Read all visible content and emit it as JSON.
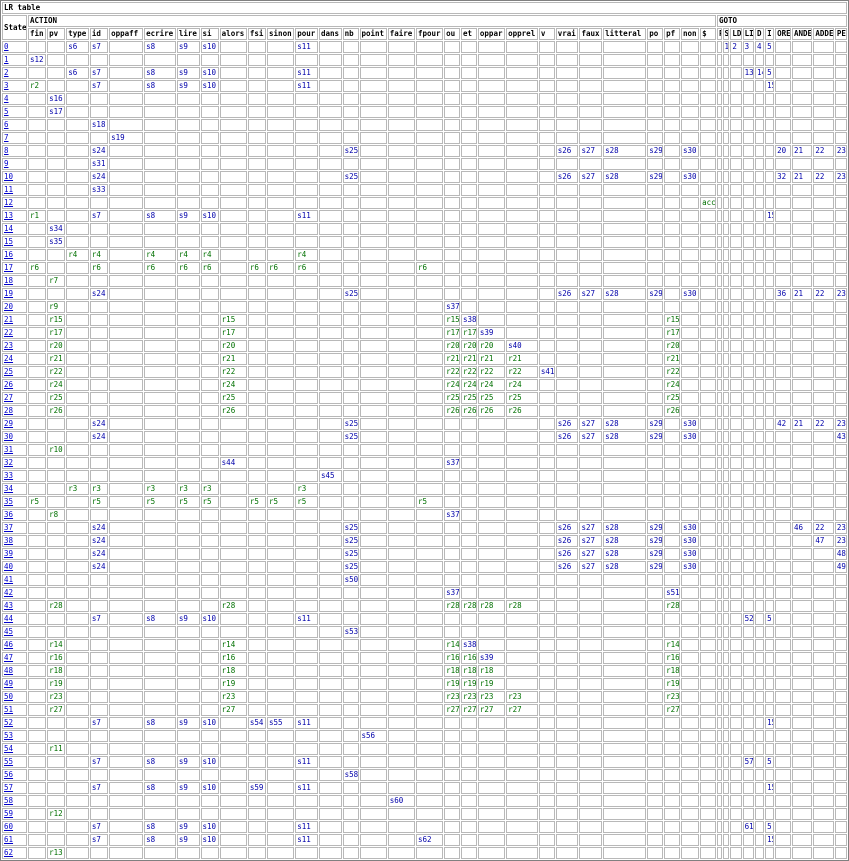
{
  "table_title": "LR table",
  "group_headers": {
    "state": "State",
    "action": "ACTION",
    "goto": "GOTO"
  },
  "action_columns": [
    "fin",
    "pv",
    "type",
    "id",
    "oppaff",
    "ecrire",
    "lire",
    "si",
    "alors",
    "fsi",
    "sinon",
    "pour",
    "dans",
    "nb",
    "point",
    "faire",
    "fpour",
    "ou",
    "et",
    "oppar",
    "opprel",
    "v",
    "vrai",
    "faux",
    "litteral",
    "po",
    "pf",
    "non",
    "$"
  ],
  "goto_columns": [
    "P",
    "S",
    "LD",
    "LI",
    "D",
    "I",
    "ORE",
    "ANDE",
    "ADDE",
    "PE"
  ],
  "rows": [
    {
      "state": "0",
      "cells": {
        "type": "s6",
        "id": "s7",
        "ecrire": "s8",
        "lire": "s9",
        "si": "s10",
        "pour": "s11",
        "S": "1",
        "LD": "2",
        "LI": "3",
        "D": "4",
        "I": "5"
      }
    },
    {
      "state": "1",
      "cells": {
        "fin": "s12"
      }
    },
    {
      "state": "2",
      "cells": {
        "type": "s6",
        "id": "s7",
        "ecrire": "s8",
        "lire": "s9",
        "si": "s10",
        "pour": "s11",
        "LI": "13",
        "D": "14",
        "I": "5"
      }
    },
    {
      "state": "3",
      "cells": {
        "fin": "r2",
        "id": "s7",
        "ecrire": "s8",
        "lire": "s9",
        "si": "s10",
        "pour": "s11",
        "I": "15"
      }
    },
    {
      "state": "4",
      "cells": {
        "pv": "s16"
      }
    },
    {
      "state": "5",
      "cells": {
        "pv": "s17"
      }
    },
    {
      "state": "6",
      "cells": {
        "id": "s18"
      }
    },
    {
      "state": "7",
      "cells": {
        "oppaff": "s19"
      }
    },
    {
      "state": "8",
      "cells": {
        "id": "s24",
        "nb": "s25",
        "vrai": "s26",
        "faux": "s27",
        "litteral": "s28",
        "po": "s29",
        "non": "s30",
        "ORE": "20",
        "ANDE": "21",
        "ADDE": "22",
        "PE": "23"
      }
    },
    {
      "state": "9",
      "cells": {
        "id": "s31"
      }
    },
    {
      "state": "10",
      "cells": {
        "id": "s24",
        "nb": "s25",
        "vrai": "s26",
        "faux": "s27",
        "litteral": "s28",
        "po": "s29",
        "non": "s30",
        "ORE": "32",
        "ANDE": "21",
        "ADDE": "22",
        "PE": "23"
      }
    },
    {
      "state": "11",
      "cells": {
        "id": "s33"
      }
    },
    {
      "state": "12",
      "cells": {
        "$": "acc"
      }
    },
    {
      "state": "13",
      "cells": {
        "fin": "r1",
        "id": "s7",
        "ecrire": "s8",
        "lire": "s9",
        "si": "s10",
        "pour": "s11",
        "I": "15"
      }
    },
    {
      "state": "14",
      "cells": {
        "pv": "s34"
      }
    },
    {
      "state": "15",
      "cells": {
        "pv": "s35"
      }
    },
    {
      "state": "16",
      "cells": {
        "type": "r4",
        "id": "r4",
        "ecrire": "r4",
        "lire": "r4",
        "si": "r4",
        "pour": "r4"
      }
    },
    {
      "state": "17",
      "cells": {
        "fin": "r6",
        "id": "r6",
        "ecrire": "r6",
        "lire": "r6",
        "si": "r6",
        "fsi": "r6",
        "sinon": "r6",
        "pour": "r6",
        "fpour": "r6"
      }
    },
    {
      "state": "18",
      "cells": {
        "pv": "r7"
      }
    },
    {
      "state": "19",
      "cells": {
        "id": "s24",
        "nb": "s25",
        "vrai": "s26",
        "faux": "s27",
        "litteral": "s28",
        "po": "s29",
        "non": "s30",
        "ORE": "36",
        "ANDE": "21",
        "ADDE": "22",
        "PE": "23"
      }
    },
    {
      "state": "20",
      "cells": {
        "pv": "r9",
        "ou": "s37"
      }
    },
    {
      "state": "21",
      "cells": {
        "pv": "r15",
        "alors": "r15",
        "ou": "r15",
        "et": "s38",
        "pf": "r15"
      }
    },
    {
      "state": "22",
      "cells": {
        "pv": "r17",
        "alors": "r17",
        "ou": "r17",
        "et": "r17",
        "oppar": "s39",
        "pf": "r17"
      }
    },
    {
      "state": "23",
      "cells": {
        "pv": "r20",
        "alors": "r20",
        "ou": "r20",
        "et": "r20",
        "oppar": "r20",
        "opprel": "s40",
        "pf": "r20"
      }
    },
    {
      "state": "24",
      "cells": {
        "pv": "r21",
        "alors": "r21",
        "ou": "r21",
        "et": "r21",
        "oppar": "r21",
        "opprel": "r21",
        "pf": "r21"
      }
    },
    {
      "state": "25",
      "cells": {
        "pv": "r22",
        "alors": "r22",
        "ou": "r22",
        "et": "r22",
        "oppar": "r22",
        "opprel": "r22",
        "v": "s41",
        "pf": "r22"
      }
    },
    {
      "state": "26",
      "cells": {
        "pv": "r24",
        "alors": "r24",
        "ou": "r24",
        "et": "r24",
        "oppar": "r24",
        "opprel": "r24",
        "pf": "r24"
      }
    },
    {
      "state": "27",
      "cells": {
        "pv": "r25",
        "alors": "r25",
        "ou": "r25",
        "et": "r25",
        "oppar": "r25",
        "opprel": "r25",
        "pf": "r25"
      }
    },
    {
      "state": "28",
      "cells": {
        "pv": "r26",
        "alors": "r26",
        "ou": "r26",
        "et": "r26",
        "oppar": "r26",
        "opprel": "r26",
        "pf": "r26"
      }
    },
    {
      "state": "29",
      "cells": {
        "id": "s24",
        "nb": "s25",
        "vrai": "s26",
        "faux": "s27",
        "litteral": "s28",
        "po": "s29",
        "non": "s30",
        "ORE": "42",
        "ANDE": "21",
        "ADDE": "22",
        "PE": "23"
      }
    },
    {
      "state": "30",
      "cells": {
        "id": "s24",
        "nb": "s25",
        "vrai": "s26",
        "faux": "s27",
        "litteral": "s28",
        "po": "s29",
        "non": "s30",
        "PE": "43"
      }
    },
    {
      "state": "31",
      "cells": {
        "pv": "r10"
      }
    },
    {
      "state": "32",
      "cells": {
        "alors": "s44",
        "ou": "s37"
      }
    },
    {
      "state": "33",
      "cells": {
        "dans": "s45"
      }
    },
    {
      "state": "34",
      "cells": {
        "type": "r3",
        "id": "r3",
        "ecrire": "r3",
        "lire": "r3",
        "si": "r3",
        "pour": "r3"
      }
    },
    {
      "state": "35",
      "cells": {
        "fin": "r5",
        "id": "r5",
        "ecrire": "r5",
        "lire": "r5",
        "si": "r5",
        "fsi": "r5",
        "sinon": "r5",
        "pour": "r5",
        "fpour": "r5"
      }
    },
    {
      "state": "36",
      "cells": {
        "pv": "r8",
        "ou": "s37"
      }
    },
    {
      "state": "37",
      "cells": {
        "id": "s24",
        "nb": "s25",
        "vrai": "s26",
        "faux": "s27",
        "litteral": "s28",
        "po": "s29",
        "non": "s30",
        "ANDE": "46",
        "ADDE": "22",
        "PE": "23"
      }
    },
    {
      "state": "38",
      "cells": {
        "id": "s24",
        "nb": "s25",
        "vrai": "s26",
        "faux": "s27",
        "litteral": "s28",
        "po": "s29",
        "non": "s30",
        "ADDE": "47",
        "PE": "23"
      }
    },
    {
      "state": "39",
      "cells": {
        "id": "s24",
        "nb": "s25",
        "vrai": "s26",
        "faux": "s27",
        "litteral": "s28",
        "po": "s29",
        "non": "s30",
        "PE": "48"
      }
    },
    {
      "state": "40",
      "cells": {
        "id": "s24",
        "nb": "s25",
        "vrai": "s26",
        "faux": "s27",
        "litteral": "s28",
        "po": "s29",
        "non": "s30",
        "PE": "49"
      }
    },
    {
      "state": "41",
      "cells": {
        "nb": "s50"
      }
    },
    {
      "state": "42",
      "cells": {
        "ou": "s37",
        "pf": "s51"
      }
    },
    {
      "state": "43",
      "cells": {
        "pv": "r28",
        "alors": "r28",
        "ou": "r28",
        "et": "r28",
        "oppar": "r28",
        "opprel": "r28",
        "pf": "r28"
      }
    },
    {
      "state": "44",
      "cells": {
        "id": "s7",
        "ecrire": "s8",
        "lire": "s9",
        "si": "s10",
        "pour": "s11",
        "LI": "52",
        "I": "5"
      }
    },
    {
      "state": "45",
      "cells": {
        "nb": "s53"
      }
    },
    {
      "state": "46",
      "cells": {
        "pv": "r14",
        "alors": "r14",
        "ou": "r14",
        "et": "s38",
        "pf": "r14"
      }
    },
    {
      "state": "47",
      "cells": {
        "pv": "r16",
        "alors": "r16",
        "ou": "r16",
        "et": "r16",
        "oppar": "s39",
        "pf": "r16"
      }
    },
    {
      "state": "48",
      "cells": {
        "pv": "r18",
        "alors": "r18",
        "ou": "r18",
        "et": "r18",
        "oppar": "r18",
        "pf": "r18"
      }
    },
    {
      "state": "49",
      "cells": {
        "pv": "r19",
        "alors": "r19",
        "ou": "r19",
        "et": "r19",
        "oppar": "r19",
        "pf": "r19"
      }
    },
    {
      "state": "50",
      "cells": {
        "pv": "r23",
        "alors": "r23",
        "ou": "r23",
        "et": "r23",
        "oppar": "r23",
        "opprel": "r23",
        "pf": "r23"
      }
    },
    {
      "state": "51",
      "cells": {
        "pv": "r27",
        "alors": "r27",
        "ou": "r27",
        "et": "r27",
        "oppar": "r27",
        "opprel": "r27",
        "pf": "r27"
      }
    },
    {
      "state": "52",
      "cells": {
        "id": "s7",
        "ecrire": "s8",
        "lire": "s9",
        "si": "s10",
        "fsi": "s54",
        "sinon": "s55",
        "pour": "s11",
        "I": "15"
      }
    },
    {
      "state": "53",
      "cells": {
        "point": "s56"
      }
    },
    {
      "state": "54",
      "cells": {
        "pv": "r11"
      }
    },
    {
      "state": "55",
      "cells": {
        "id": "s7",
        "ecrire": "s8",
        "lire": "s9",
        "si": "s10",
        "pour": "s11",
        "LI": "57",
        "I": "5"
      }
    },
    {
      "state": "56",
      "cells": {
        "nb": "s58"
      }
    },
    {
      "state": "57",
      "cells": {
        "id": "s7",
        "ecrire": "s8",
        "lire": "s9",
        "si": "s10",
        "fsi": "s59",
        "pour": "s11",
        "I": "15"
      }
    },
    {
      "state": "58",
      "cells": {
        "faire": "s60"
      }
    },
    {
      "state": "59",
      "cells": {
        "pv": "r12"
      }
    },
    {
      "state": "60",
      "cells": {
        "id": "s7",
        "ecrire": "s8",
        "lire": "s9",
        "si": "s10",
        "pour": "s11",
        "LI": "61",
        "I": "5"
      }
    },
    {
      "state": "61",
      "cells": {
        "id": "s7",
        "ecrire": "s8",
        "lire": "s9",
        "si": "s10",
        "pour": "s11",
        "fpour": "s62",
        "I": "15"
      }
    },
    {
      "state": "62",
      "cells": {
        "pv": "r13"
      }
    }
  ]
}
